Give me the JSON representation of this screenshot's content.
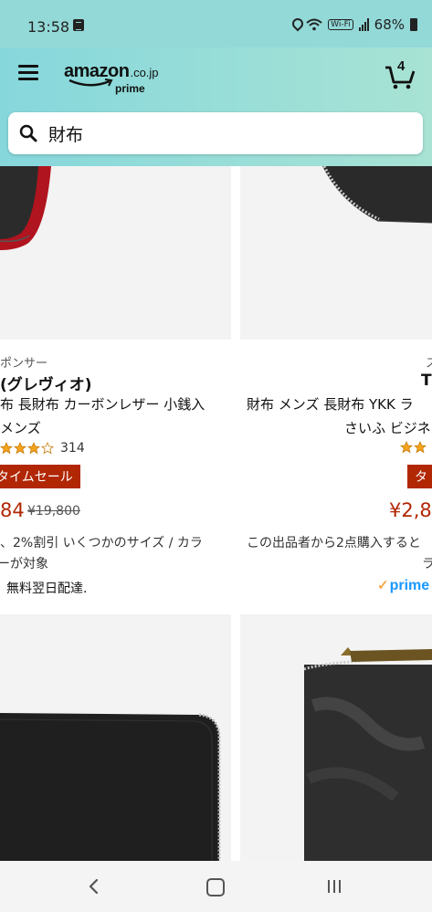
{
  "status": {
    "time": "13:58",
    "battery": "68%",
    "wifi_call": "Wi-Fi",
    "icons": [
      "note-icon",
      "location-icon",
      "wifi-icon",
      "signal-icon",
      "battery-icon"
    ]
  },
  "header": {
    "logo_word": "amazon",
    "logo_tld": ".co.jp",
    "logo_prime": "prime",
    "cart_count": "4",
    "icons": [
      "menu-icon",
      "cart-icon",
      "search-icon"
    ]
  },
  "search": {
    "value": "財布"
  },
  "products": [
    {
      "sponsored": "ポンサー",
      "brand": "(グレヴィオ)",
      "title_line1": "布 長財布 カーボンレザー 小銭入",
      "title_line2": "メンズ",
      "rating_stars": 3,
      "rating_count": "314",
      "deal": "タイムセール",
      "price": "84",
      "list_price": "¥19,800",
      "note_line1": "、2%割引 いくつかのサイズ / カラ",
      "note_line2": "ーが対象",
      "delivery": "無料翌日配達."
    },
    {
      "sponsored": "ス",
      "brand": "T",
      "title_line1": "財布 メンズ 長財布 YKK ラ",
      "title_line2": "さいふ ビジネ",
      "deal": "タ",
      "price": "¥2,8",
      "note_line1": "この出品者から2点購入すると",
      "note_line2": "ラ",
      "prime": "prime"
    }
  ],
  "colors": {
    "header_gradient_start": "#86d7dc",
    "header_gradient_end": "#a8e3d4",
    "deal_red": "#b12704",
    "prime_blue": "#1a98ff",
    "star_orange": "#f4a41c"
  },
  "nav": {
    "icons": [
      "back-icon",
      "home-icon",
      "recent-apps-icon"
    ]
  }
}
